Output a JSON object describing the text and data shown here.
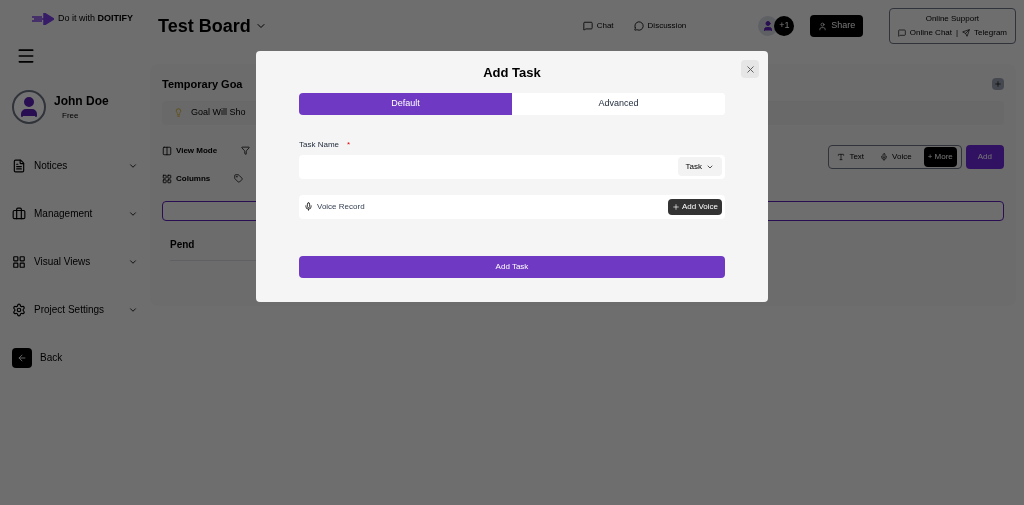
{
  "brand": {
    "tagline": "Do it with **DOITIFY**"
  },
  "header": {
    "title": "Test Board",
    "links": [
      {
        "label": "Chat"
      },
      {
        "label": "Discussion"
      }
    ],
    "member_count": "+1",
    "share": "Share",
    "support": {
      "title": "Online Support",
      "chat": "Online Chat",
      "separator": "|",
      "telegram": "Telegram"
    }
  },
  "user": {
    "name": "John Doe",
    "plan": "Free"
  },
  "sidebar": {
    "items": [
      {
        "label": "Notices",
        "kind": "notices"
      },
      {
        "label": "Management",
        "kind": "management"
      },
      {
        "label": "Visual Views",
        "kind": "views"
      },
      {
        "label": "Project Settings",
        "kind": "settings"
      }
    ],
    "back": "Back"
  },
  "board": {
    "goal_title": "Temporary Goa",
    "goal_text": "Goal Will Sho",
    "toolbar": [
      {
        "label": "View Mode",
        "kind": "view"
      },
      {
        "label": "Columns",
        "kind": "columns"
      }
    ],
    "input_modes": [
      {
        "label": "Text",
        "selected": false
      },
      {
        "label": "Voice",
        "selected": false
      },
      {
        "label": "+ More",
        "selected": true
      }
    ],
    "add": "Add",
    "column_title": "Pend"
  },
  "dialog": {
    "title": "Add Task",
    "tabs": [
      {
        "label": "Default",
        "selected": true
      },
      {
        "label": "Advanced",
        "selected": false
      }
    ],
    "task_label": "Task Name",
    "required": "*",
    "type_button": "Task",
    "voice_label": "Voice Record",
    "add_voice": "Add Voice",
    "submit": "Add Task"
  }
}
